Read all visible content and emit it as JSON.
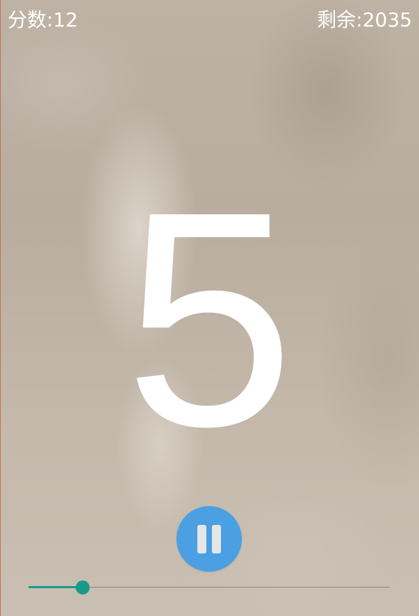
{
  "hud": {
    "score_text": "分数:12",
    "remaining_text": "剩余:2035"
  },
  "countdown": {
    "value": "5"
  },
  "controls": {
    "pause_icon": "pause-icon",
    "accent_color": "#4b9fe3"
  },
  "progress": {
    "fraction": 0.15,
    "color": "#179a8a"
  }
}
